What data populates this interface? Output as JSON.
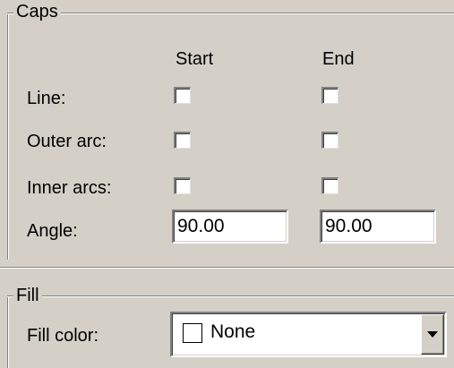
{
  "caps": {
    "title": "Caps",
    "col_start": "Start",
    "col_end": "End",
    "rows": [
      {
        "label": "Line:",
        "start_checked": false,
        "end_checked": false
      },
      {
        "label": "Outer arc:",
        "start_checked": false,
        "end_checked": false
      },
      {
        "label": "Inner arcs:",
        "start_checked": false,
        "end_checked": false
      }
    ],
    "angle": {
      "label": "Angle:",
      "start_value": "90.00",
      "end_value": "90.00"
    }
  },
  "fill": {
    "title": "Fill",
    "color_label": "Fill color:",
    "color_value": "None",
    "swatch_color": "#ffffff"
  },
  "colors": {
    "face": "#d4d0c8",
    "shadow": "#808080",
    "highlight": "#ffffff"
  }
}
